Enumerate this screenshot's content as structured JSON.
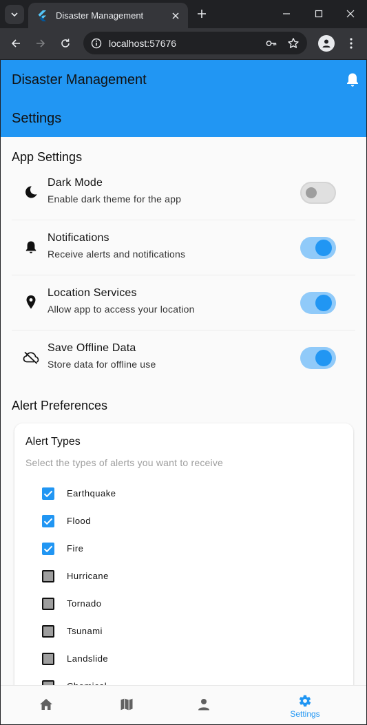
{
  "browser": {
    "tab_title": "Disaster Management",
    "url": "localhost:57676"
  },
  "app": {
    "title": "Disaster Management",
    "page_title": "Settings",
    "accent": "#2196f3"
  },
  "app_settings": {
    "heading": "App Settings",
    "items": [
      {
        "title": "Dark Mode",
        "subtitle": "Enable dark theme for the app",
        "icon": "moon-icon",
        "enabled": false
      },
      {
        "title": "Notifications",
        "subtitle": "Receive alerts and notifications",
        "icon": "bell-icon",
        "enabled": true
      },
      {
        "title": "Location Services",
        "subtitle": "Allow app to access your location",
        "icon": "location-pin-icon",
        "enabled": true
      },
      {
        "title": "Save Offline Data",
        "subtitle": "Store data for offline use",
        "icon": "cloud-off-icon",
        "enabled": true
      }
    ]
  },
  "alert_prefs": {
    "heading": "Alert Preferences",
    "card_title": "Alert Types",
    "card_subtitle": "Select the types of alerts you want to receive",
    "types": [
      {
        "label": "Earthquake",
        "checked": true
      },
      {
        "label": "Flood",
        "checked": true
      },
      {
        "label": "Fire",
        "checked": true
      },
      {
        "label": "Hurricane",
        "checked": false
      },
      {
        "label": "Tornado",
        "checked": false
      },
      {
        "label": "Tsunami",
        "checked": false
      },
      {
        "label": "Landslide",
        "checked": false
      },
      {
        "label": "Chemical",
        "checked": false
      }
    ]
  },
  "bottom_nav": {
    "items": [
      {
        "icon": "home-icon",
        "label": ""
      },
      {
        "icon": "map-icon",
        "label": ""
      },
      {
        "icon": "person-icon",
        "label": ""
      },
      {
        "icon": "gear-icon",
        "label": "Settings"
      }
    ],
    "active_index": 3
  }
}
